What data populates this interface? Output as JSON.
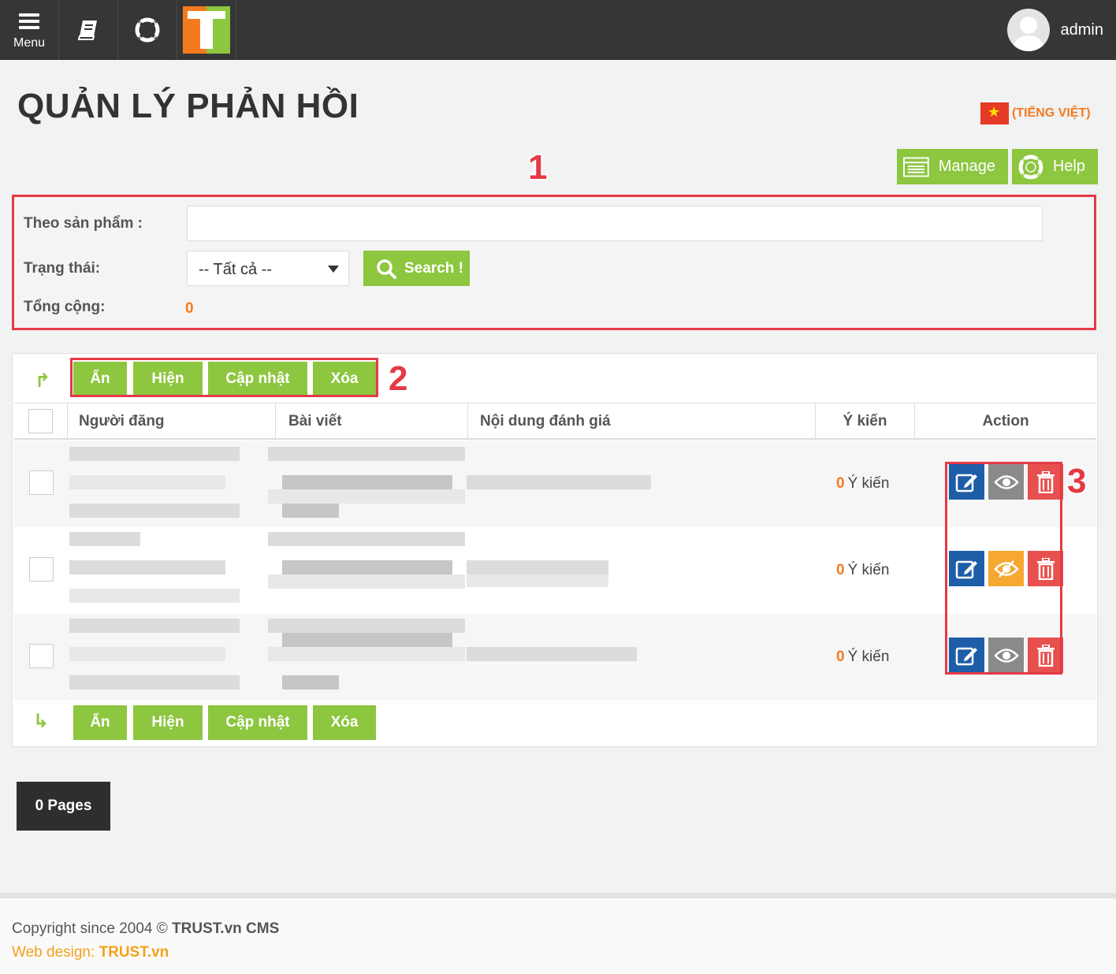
{
  "topbar": {
    "menu_label": "Menu",
    "user_name": "admin",
    "icons": [
      "menu-icon",
      "book-icon",
      "lifebuoy-icon",
      "logo-icon",
      "avatar-icon"
    ]
  },
  "header": {
    "title": "QUẢN LÝ PHẢN HỒI",
    "language": "(TIẾNG VIỆT)",
    "manage_label": "Manage",
    "help_label": "Help"
  },
  "filter": {
    "product_label": "Theo sản phẩm :",
    "product_value": "",
    "status_label": "Trạng thái:",
    "status_selected": "-- Tất cả --",
    "search_label": "Search !",
    "total_label": "Tổng cộng:",
    "total_value": "0"
  },
  "actions": {
    "hide": "Ẩn",
    "show": "Hiện",
    "update": "Cập nhật",
    "delete": "Xóa"
  },
  "table": {
    "columns": [
      "Người đăng",
      "Bài viết",
      "Nội dung đánh giá",
      "Ý kiến",
      "Action"
    ],
    "rows": [
      {
        "opinion_count": "0",
        "opinion_label": "Ý kiến",
        "visibility": "visible"
      },
      {
        "opinion_count": "0",
        "opinion_label": "Ý kiến",
        "visibility": "hidden"
      },
      {
        "opinion_count": "0",
        "opinion_label": "Ý kiến",
        "visibility": "visible"
      }
    ]
  },
  "pagination": {
    "label": "0 Pages"
  },
  "annotations": {
    "n1": "1",
    "n2": "2",
    "n3": "3"
  },
  "footer": {
    "copyright_prefix": "Copyright since 2004 ©",
    "copyright_brand": "TRUST.vn CMS",
    "design_prefix": "Web design:",
    "design_brand": "TRUST.vn"
  },
  "colors": {
    "accent_green": "#8dc63f",
    "accent_orange": "#f47a20",
    "edit_blue": "#1e5ea8",
    "delete_red": "#e8504f",
    "annotation_red": "#e53a45"
  }
}
